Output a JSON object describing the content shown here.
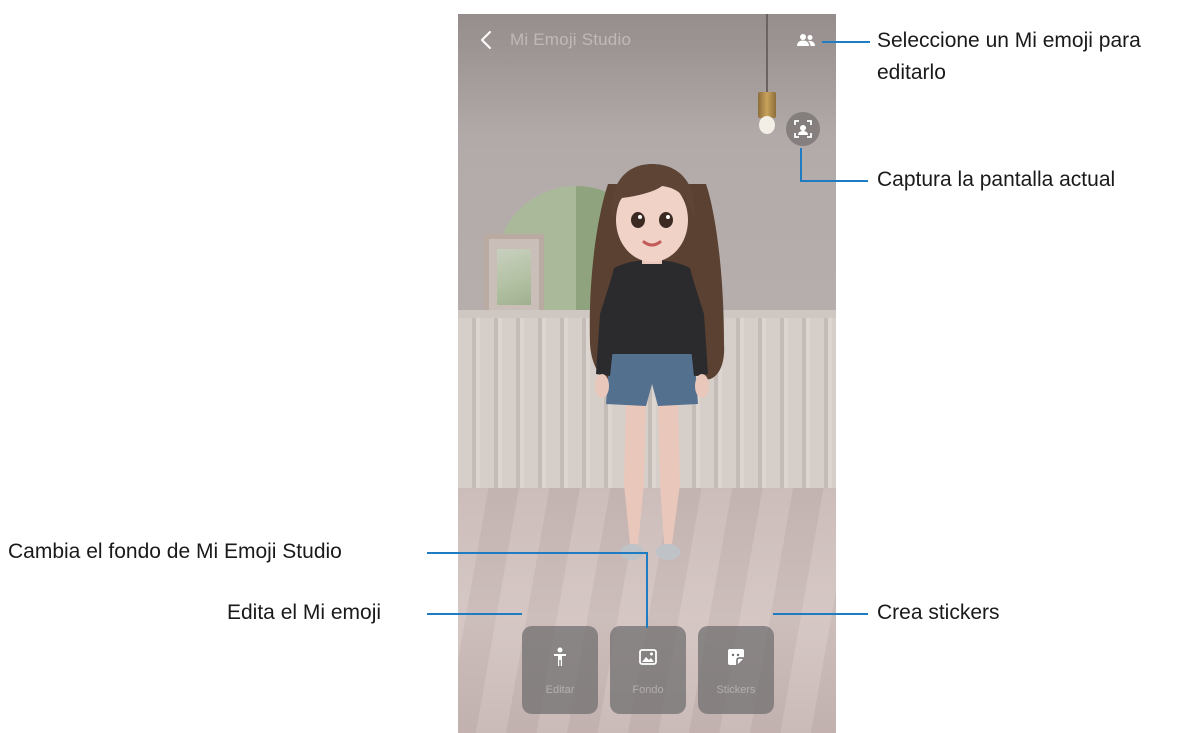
{
  "colors": {
    "leader_line": "#1f7bc2",
    "toolbar_button_bg": "#6e6c6e",
    "screen_wall": "#b3abaa",
    "screen_floor": "#d3c4c1"
  },
  "screen": {
    "top_bar": {
      "back_icon": "chevron-left-icon",
      "title": "Mi Emoji Studio",
      "select_icon": "people-icon"
    },
    "capture_icon": "face-capture-icon",
    "toolbar": [
      {
        "id": "edit",
        "icon": "person-icon",
        "label": "Editar"
      },
      {
        "id": "background",
        "icon": "image-icon",
        "label": "Fondo"
      },
      {
        "id": "stickers",
        "icon": "sticker-icon",
        "label": "Stickers"
      }
    ]
  },
  "callouts": {
    "select_emoji_line1": "Seleccione un Mi emoji para",
    "select_emoji_line2": "editarlo",
    "capture": "Captura la pantalla actual",
    "change_background": "Cambia el fondo de Mi Emoji Studio",
    "edit_emoji": "Edita el Mi emoji",
    "create_stickers": "Crea stickers"
  }
}
